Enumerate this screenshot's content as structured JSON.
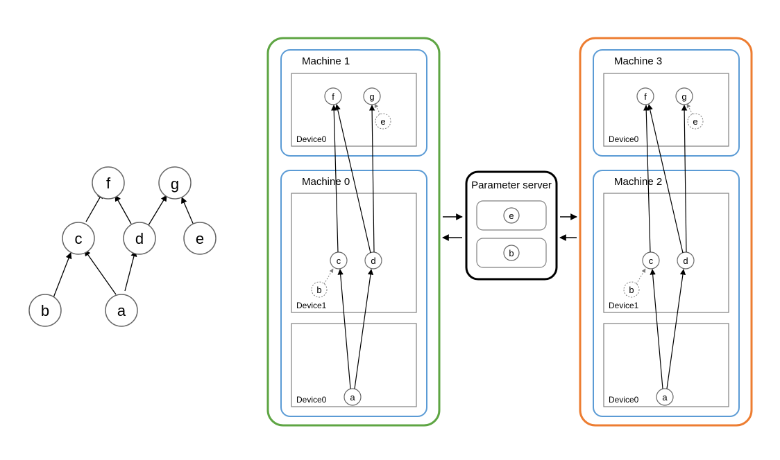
{
  "dag": {
    "nodes": {
      "a": "a",
      "b": "b",
      "c": "c",
      "d": "d",
      "e": "e",
      "f": "f",
      "g": "g"
    },
    "edges": [
      [
        "a",
        "c"
      ],
      [
        "a",
        "d"
      ],
      [
        "b",
        "c"
      ],
      [
        "c",
        "f"
      ],
      [
        "d",
        "f"
      ],
      [
        "d",
        "g"
      ],
      [
        "e",
        "g"
      ]
    ]
  },
  "machines": {
    "m1": {
      "title": "Machine 1",
      "device_top_label": "Device0",
      "nodes": {
        "f": "f",
        "g": "g",
        "e": "e"
      }
    },
    "m0": {
      "title": "Machine 0",
      "device_mid_label": "Device1",
      "device_bot_label": "Device0",
      "nodes": {
        "c": "c",
        "d": "d",
        "b": "b",
        "a": "a"
      }
    },
    "m3": {
      "title": "Machine 3",
      "device_top_label": "Device0",
      "nodes": {
        "f": "f",
        "g": "g",
        "e": "e"
      }
    },
    "m2": {
      "title": "Machine 2",
      "device_mid_label": "Device1",
      "device_bot_label": "Device0",
      "nodes": {
        "c": "c",
        "d": "d",
        "b": "b",
        "a": "a"
      }
    }
  },
  "parameter_server": {
    "title": "Parameter server",
    "params": {
      "e": "e",
      "b": "b"
    }
  },
  "colors": {
    "green": "#5ea543",
    "orange": "#ed7d31",
    "blue": "#5b9bd5",
    "black": "#000000",
    "grey": "#7f7f7f",
    "node_stroke": "#666666"
  }
}
